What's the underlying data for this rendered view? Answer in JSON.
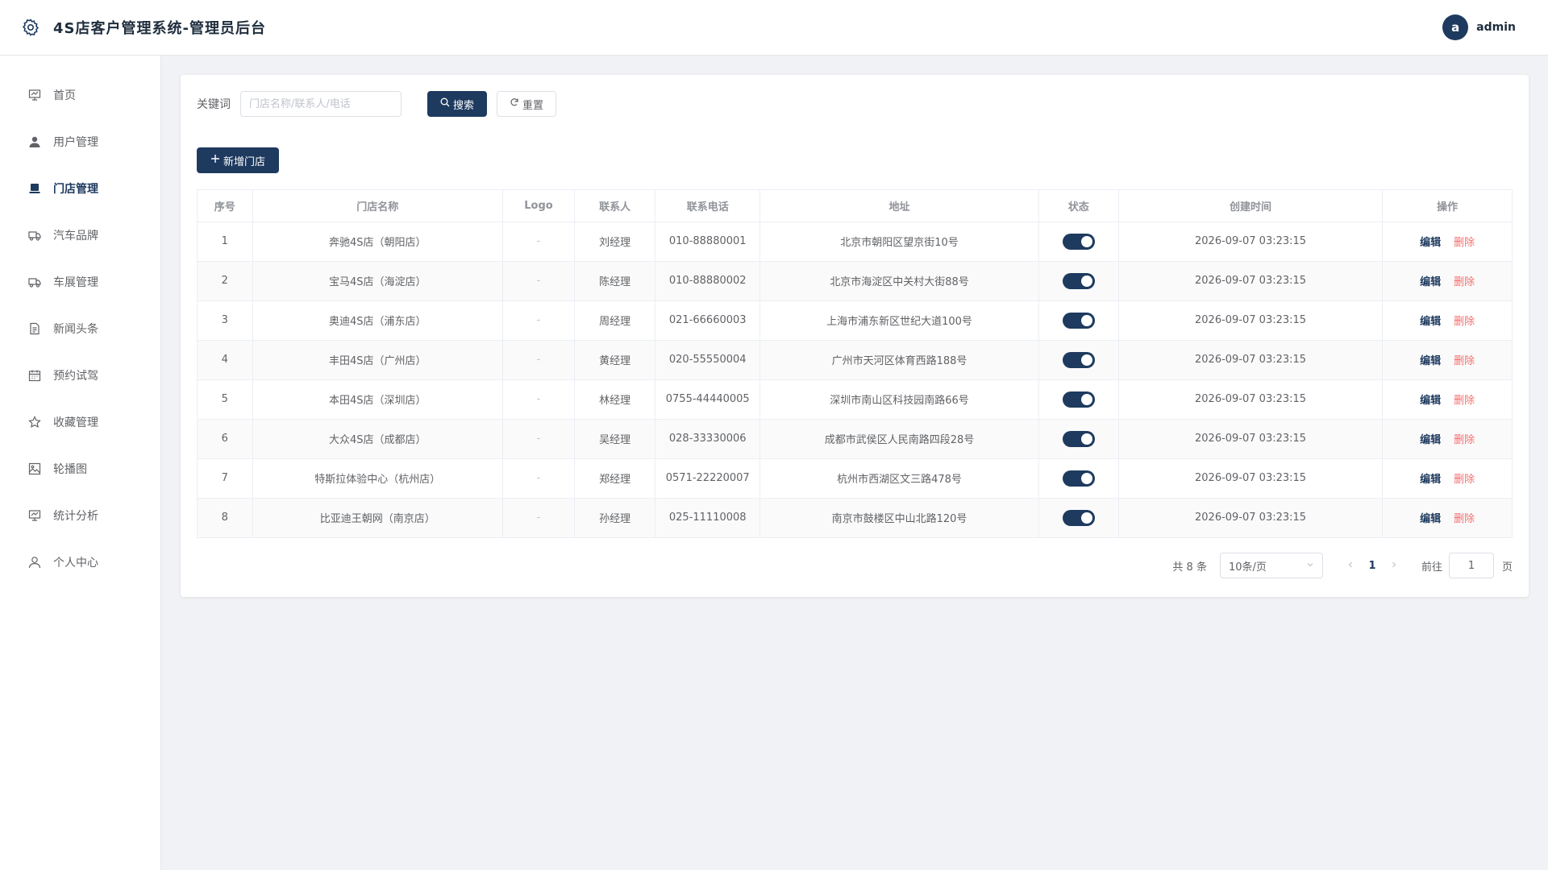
{
  "header": {
    "title": "4S店客户管理系统-管理员后台",
    "user_initial": "a",
    "username": "admin"
  },
  "sidebar": {
    "items": [
      {
        "label": "首页",
        "icon": "presentation-icon",
        "active": false
      },
      {
        "label": "用户管理",
        "icon": "user-icon",
        "active": false
      },
      {
        "label": "门店管理",
        "icon": "store-icon",
        "active": true
      },
      {
        "label": "汽车品牌",
        "icon": "truck-icon",
        "active": false
      },
      {
        "label": "车展管理",
        "icon": "truck-icon",
        "active": false
      },
      {
        "label": "新闻头条",
        "icon": "document-icon",
        "active": false
      },
      {
        "label": "预约试驾",
        "icon": "calendar-icon",
        "active": false
      },
      {
        "label": "收藏管理",
        "icon": "star-icon",
        "active": false
      },
      {
        "label": "轮播图",
        "icon": "image-icon",
        "active": false
      },
      {
        "label": "统计分析",
        "icon": "chart-icon",
        "active": false
      },
      {
        "label": "个人中心",
        "icon": "person-icon",
        "active": false
      }
    ]
  },
  "search": {
    "label": "关键词",
    "placeholder": "门店名称/联系人/电话",
    "value": "",
    "search_label": "搜索",
    "reset_label": "重置"
  },
  "actions": {
    "add_label": "新增门店"
  },
  "table": {
    "columns": [
      "序号",
      "门店名称",
      "Logo",
      "联系人",
      "联系电话",
      "地址",
      "状态",
      "创建时间",
      "操作"
    ],
    "rows": [
      {
        "no": "1",
        "name": "奔驰4S店（朝阳店）",
        "logo": "-",
        "contact": "刘经理",
        "phone": "010-88880001",
        "address": "北京市朝阳区望京街10号",
        "status": true,
        "created": "2026-09-07 03:23:15",
        "edit": "编辑",
        "delete": "删除"
      },
      {
        "no": "2",
        "name": "宝马4S店（海淀店）",
        "logo": "-",
        "contact": "陈经理",
        "phone": "010-88880002",
        "address": "北京市海淀区中关村大街88号",
        "status": true,
        "created": "2026-09-07 03:23:15",
        "edit": "编辑",
        "delete": "删除"
      },
      {
        "no": "3",
        "name": "奥迪4S店（浦东店）",
        "logo": "-",
        "contact": "周经理",
        "phone": "021-66660003",
        "address": "上海市浦东新区世纪大道100号",
        "status": true,
        "created": "2026-09-07 03:23:15",
        "edit": "编辑",
        "delete": "删除"
      },
      {
        "no": "4",
        "name": "丰田4S店（广州店）",
        "logo": "-",
        "contact": "黄经理",
        "phone": "020-55550004",
        "address": "广州市天河区体育西路188号",
        "status": true,
        "created": "2026-09-07 03:23:15",
        "edit": "编辑",
        "delete": "删除"
      },
      {
        "no": "5",
        "name": "本田4S店（深圳店）",
        "logo": "-",
        "contact": "林经理",
        "phone": "0755-44440005",
        "address": "深圳市南山区科技园南路66号",
        "status": true,
        "created": "2026-09-07 03:23:15",
        "edit": "编辑",
        "delete": "删除"
      },
      {
        "no": "6",
        "name": "大众4S店（成都店）",
        "logo": "-",
        "contact": "吴经理",
        "phone": "028-33330006",
        "address": "成都市武侯区人民南路四段28号",
        "status": true,
        "created": "2026-09-07 03:23:15",
        "edit": "编辑",
        "delete": "删除"
      },
      {
        "no": "7",
        "name": "特斯拉体验中心（杭州店）",
        "logo": "-",
        "contact": "郑经理",
        "phone": "0571-22220007",
        "address": "杭州市西湖区文三路478号",
        "status": true,
        "created": "2026-09-07 03:23:15",
        "edit": "编辑",
        "delete": "删除"
      },
      {
        "no": "8",
        "name": "比亚迪王朝网（南京店）",
        "logo": "-",
        "contact": "孙经理",
        "phone": "025-11110008",
        "address": "南京市鼓楼区中山北路120号",
        "status": true,
        "created": "2026-09-07 03:23:15",
        "edit": "编辑",
        "delete": "删除"
      }
    ]
  },
  "pagination": {
    "total_text": "共 8 条",
    "page_size": "10条/页",
    "current_page": "1",
    "goto_label": "前往",
    "goto_value": "1",
    "goto_unit": "页"
  },
  "colors": {
    "primary": "#1e3a5f",
    "danger": "#f56c6c",
    "background": "#f0f2f5"
  }
}
